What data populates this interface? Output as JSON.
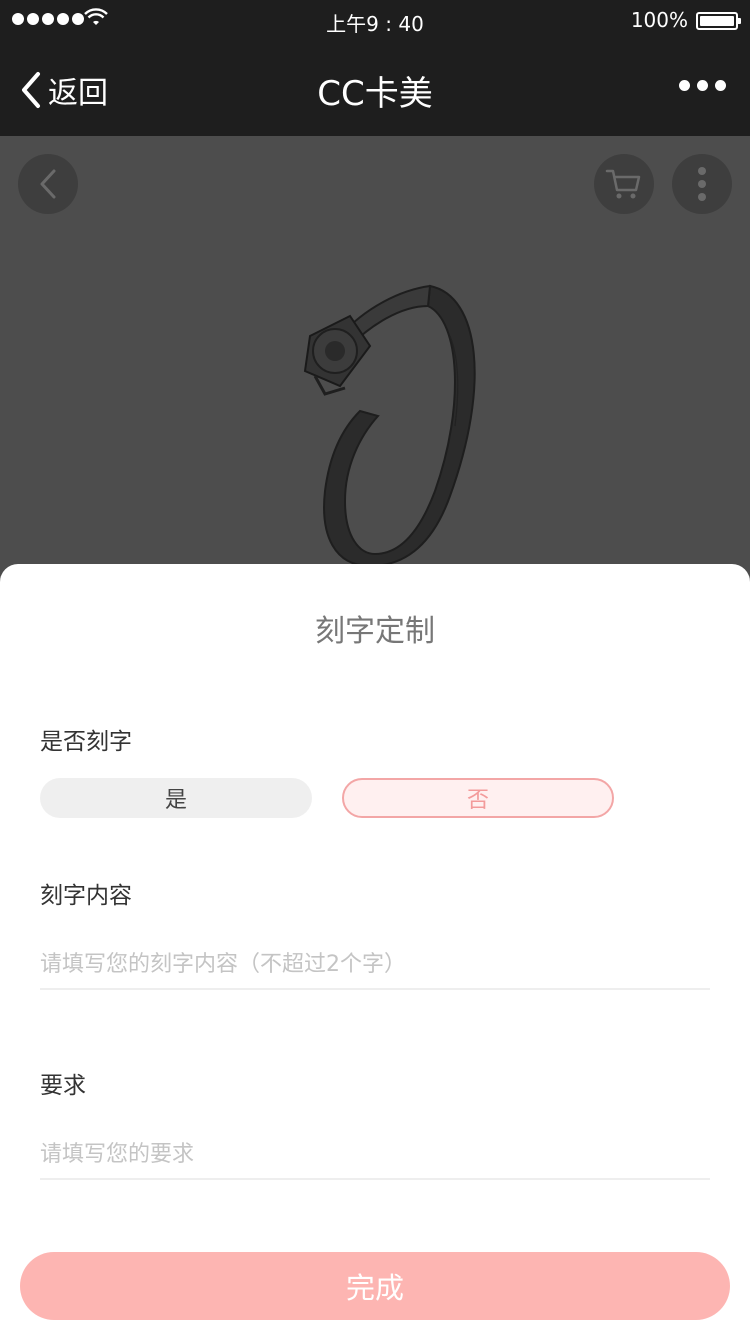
{
  "status_bar": {
    "time": "上午9 : 40",
    "battery_percent": "100%",
    "signal_icon": "signal-dots-icon",
    "wifi_icon": "wifi-icon",
    "battery_icon": "battery-icon"
  },
  "nav": {
    "back_label": "返回",
    "title": "CC卡美",
    "more_icon": "more-dots-icon"
  },
  "product": {
    "back_icon": "chevron-left-icon",
    "cart_icon": "cart-icon",
    "menu_icon": "vertical-dots-icon",
    "image": "diamond-ring"
  },
  "sheet": {
    "title": "刻字定制",
    "engrave_question": "是否刻字",
    "options": [
      {
        "label": "是",
        "selected": false
      },
      {
        "label": "否",
        "selected": true
      }
    ],
    "content_label": "刻字内容",
    "content_placeholder": "请填写您的刻字内容（不超过2个字）",
    "content_value": "",
    "requirement_label": "要求",
    "requirement_placeholder": "请填写您的要求",
    "requirement_value": "",
    "done_label": "完成"
  },
  "colors": {
    "dark_bar": "#1e1e1e",
    "accent_pink": "#fdb5b2",
    "selected_border": "#f3a6a6",
    "selected_text": "#f39b9b"
  }
}
